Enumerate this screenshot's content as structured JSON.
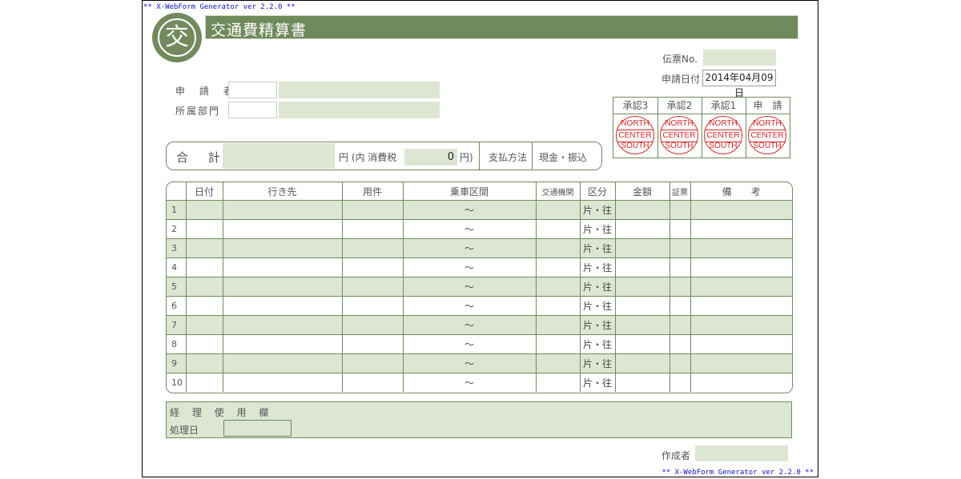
{
  "generator_top": "** X-WebForm Generator ver 2.2.0 **",
  "generator_bottom": "** X-WebForm Generator ver 2.2.0 **",
  "logo_char": "交",
  "title": "交通費精算書",
  "voucher_no_label": "伝票No.",
  "voucher_no_value": "",
  "request_date_label": "申請日付",
  "request_date_value": "2014年04月09日",
  "applicant_label": "申 請 者",
  "applicant_code": "",
  "applicant_name": "",
  "dept_label": "所属部門",
  "dept_code": "",
  "dept_name": "",
  "approval": {
    "headers": [
      "承認3",
      "承認2",
      "承認1",
      "申　請"
    ],
    "stamp": [
      "NORTH",
      "CENTER",
      "SOUTH"
    ],
    "stamp_color": "#d62828"
  },
  "total": {
    "label": "合 計",
    "amount": "",
    "yen_open": "円 (内 消費税",
    "tax": "0",
    "yen_close": "円)",
    "pay_method_label": "支払方法",
    "pay_method_value": "現金・振込"
  },
  "table": {
    "headers": [
      "",
      "日付",
      "行き先",
      "用件",
      "乗車区間",
      "交通機関",
      "区分",
      "金額",
      "証票",
      "備　　考"
    ],
    "rows": [
      {
        "no": "1",
        "range": "〜",
        "kubun": "片・往"
      },
      {
        "no": "2",
        "range": "〜",
        "kubun": "片・往"
      },
      {
        "no": "3",
        "range": "〜",
        "kubun": "片・往"
      },
      {
        "no": "4",
        "range": "〜",
        "kubun": "片・往"
      },
      {
        "no": "5",
        "range": "〜",
        "kubun": "片・往"
      },
      {
        "no": "6",
        "range": "〜",
        "kubun": "片・往"
      },
      {
        "no": "7",
        "range": "〜",
        "kubun": "片・往"
      },
      {
        "no": "8",
        "range": "〜",
        "kubun": "片・往"
      },
      {
        "no": "9",
        "range": "〜",
        "kubun": "片・往"
      },
      {
        "no": "10",
        "range": "〜",
        "kubun": "片・往"
      }
    ]
  },
  "accounting": {
    "label": "経 理 使 用 欄",
    "date_label": "処理日",
    "date_value": ""
  },
  "creator_label": "作成者",
  "creator_value": "",
  "colors": {
    "accent": "#6f8a5b",
    "field": "#dde6d2",
    "generator_text": "#1010c8"
  }
}
